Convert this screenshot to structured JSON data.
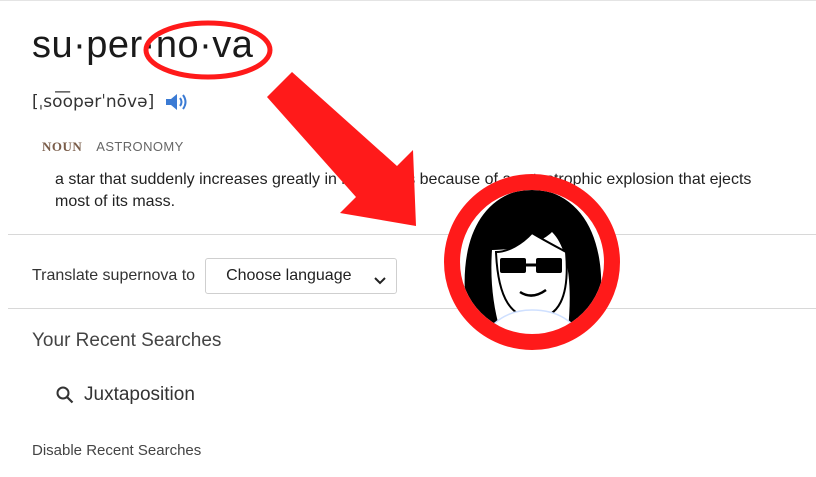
{
  "entry": {
    "word": "su·per·no·va",
    "pronunciation": "[ˌso͞opərˈnōvə]",
    "part_of_speech": "NOUN",
    "domain_label": "ASTRONOMY",
    "definition": "a star that suddenly increases greatly in brightness because of a catastrophic explosion that ejects most of its mass."
  },
  "translate": {
    "label": "Translate supernova to",
    "select_value": "Choose language"
  },
  "recent": {
    "heading": "Your Recent Searches",
    "items": [
      "Juxtaposition"
    ],
    "disable_label": "Disable Recent Searches"
  },
  "icons": {
    "speaker": "speaker-icon",
    "dropdown": "chevron-down-icon",
    "search": "search-icon"
  },
  "colors": {
    "annotation_red": "#ff1a1a",
    "speaker_blue": "#3b7bd4",
    "noun_brown": "#7a5d4a"
  }
}
